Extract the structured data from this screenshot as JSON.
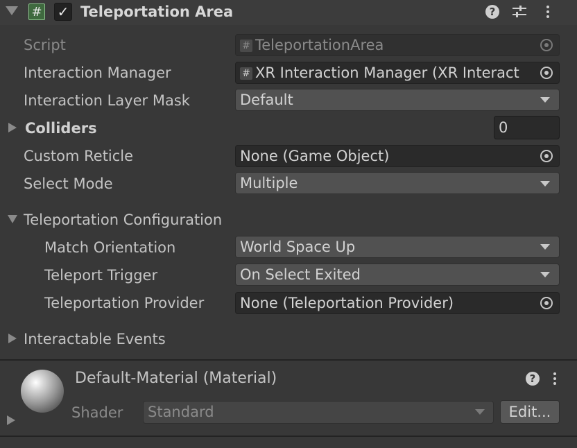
{
  "component": {
    "title": "Teleportation Area",
    "enabled": true,
    "icons": [
      "help-icon",
      "presets-icon",
      "context-menu-icon"
    ]
  },
  "fields": {
    "script": {
      "label": "Script",
      "value": "TeleportationArea"
    },
    "interaction_manager": {
      "label": "Interaction Manager",
      "value": "XR Interaction Manager (XR Interact"
    },
    "interaction_layer_mask": {
      "label": "Interaction Layer Mask",
      "value": "Default"
    },
    "colliders": {
      "label": "Colliders",
      "value": "0"
    },
    "custom_reticle": {
      "label": "Custom Reticle",
      "value": "None (Game Object)"
    },
    "select_mode": {
      "label": "Select Mode",
      "value": "Multiple"
    }
  },
  "teleport_config": {
    "label": "Teleportation Configuration",
    "match_orientation": {
      "label": "Match Orientation",
      "value": "World Space Up"
    },
    "teleport_trigger": {
      "label": "Teleport Trigger",
      "value": "On Select Exited"
    },
    "teleportation_provider": {
      "label": "Teleportation Provider",
      "value": "None (Teleportation Provider)"
    }
  },
  "events": {
    "label": "Interactable Events"
  },
  "material": {
    "title": "Default-Material (Material)",
    "shader_label": "Shader",
    "shader_value": "Standard",
    "edit_label": "Edit..."
  },
  "glyphs": {
    "hash": "#",
    "check": "✓",
    "question": "?"
  },
  "colors": {
    "background": "#383838",
    "header": "#3c3c3c",
    "object_field": "#2a2a2a",
    "dropdown": "#515151",
    "text": "#c4c4c4"
  }
}
